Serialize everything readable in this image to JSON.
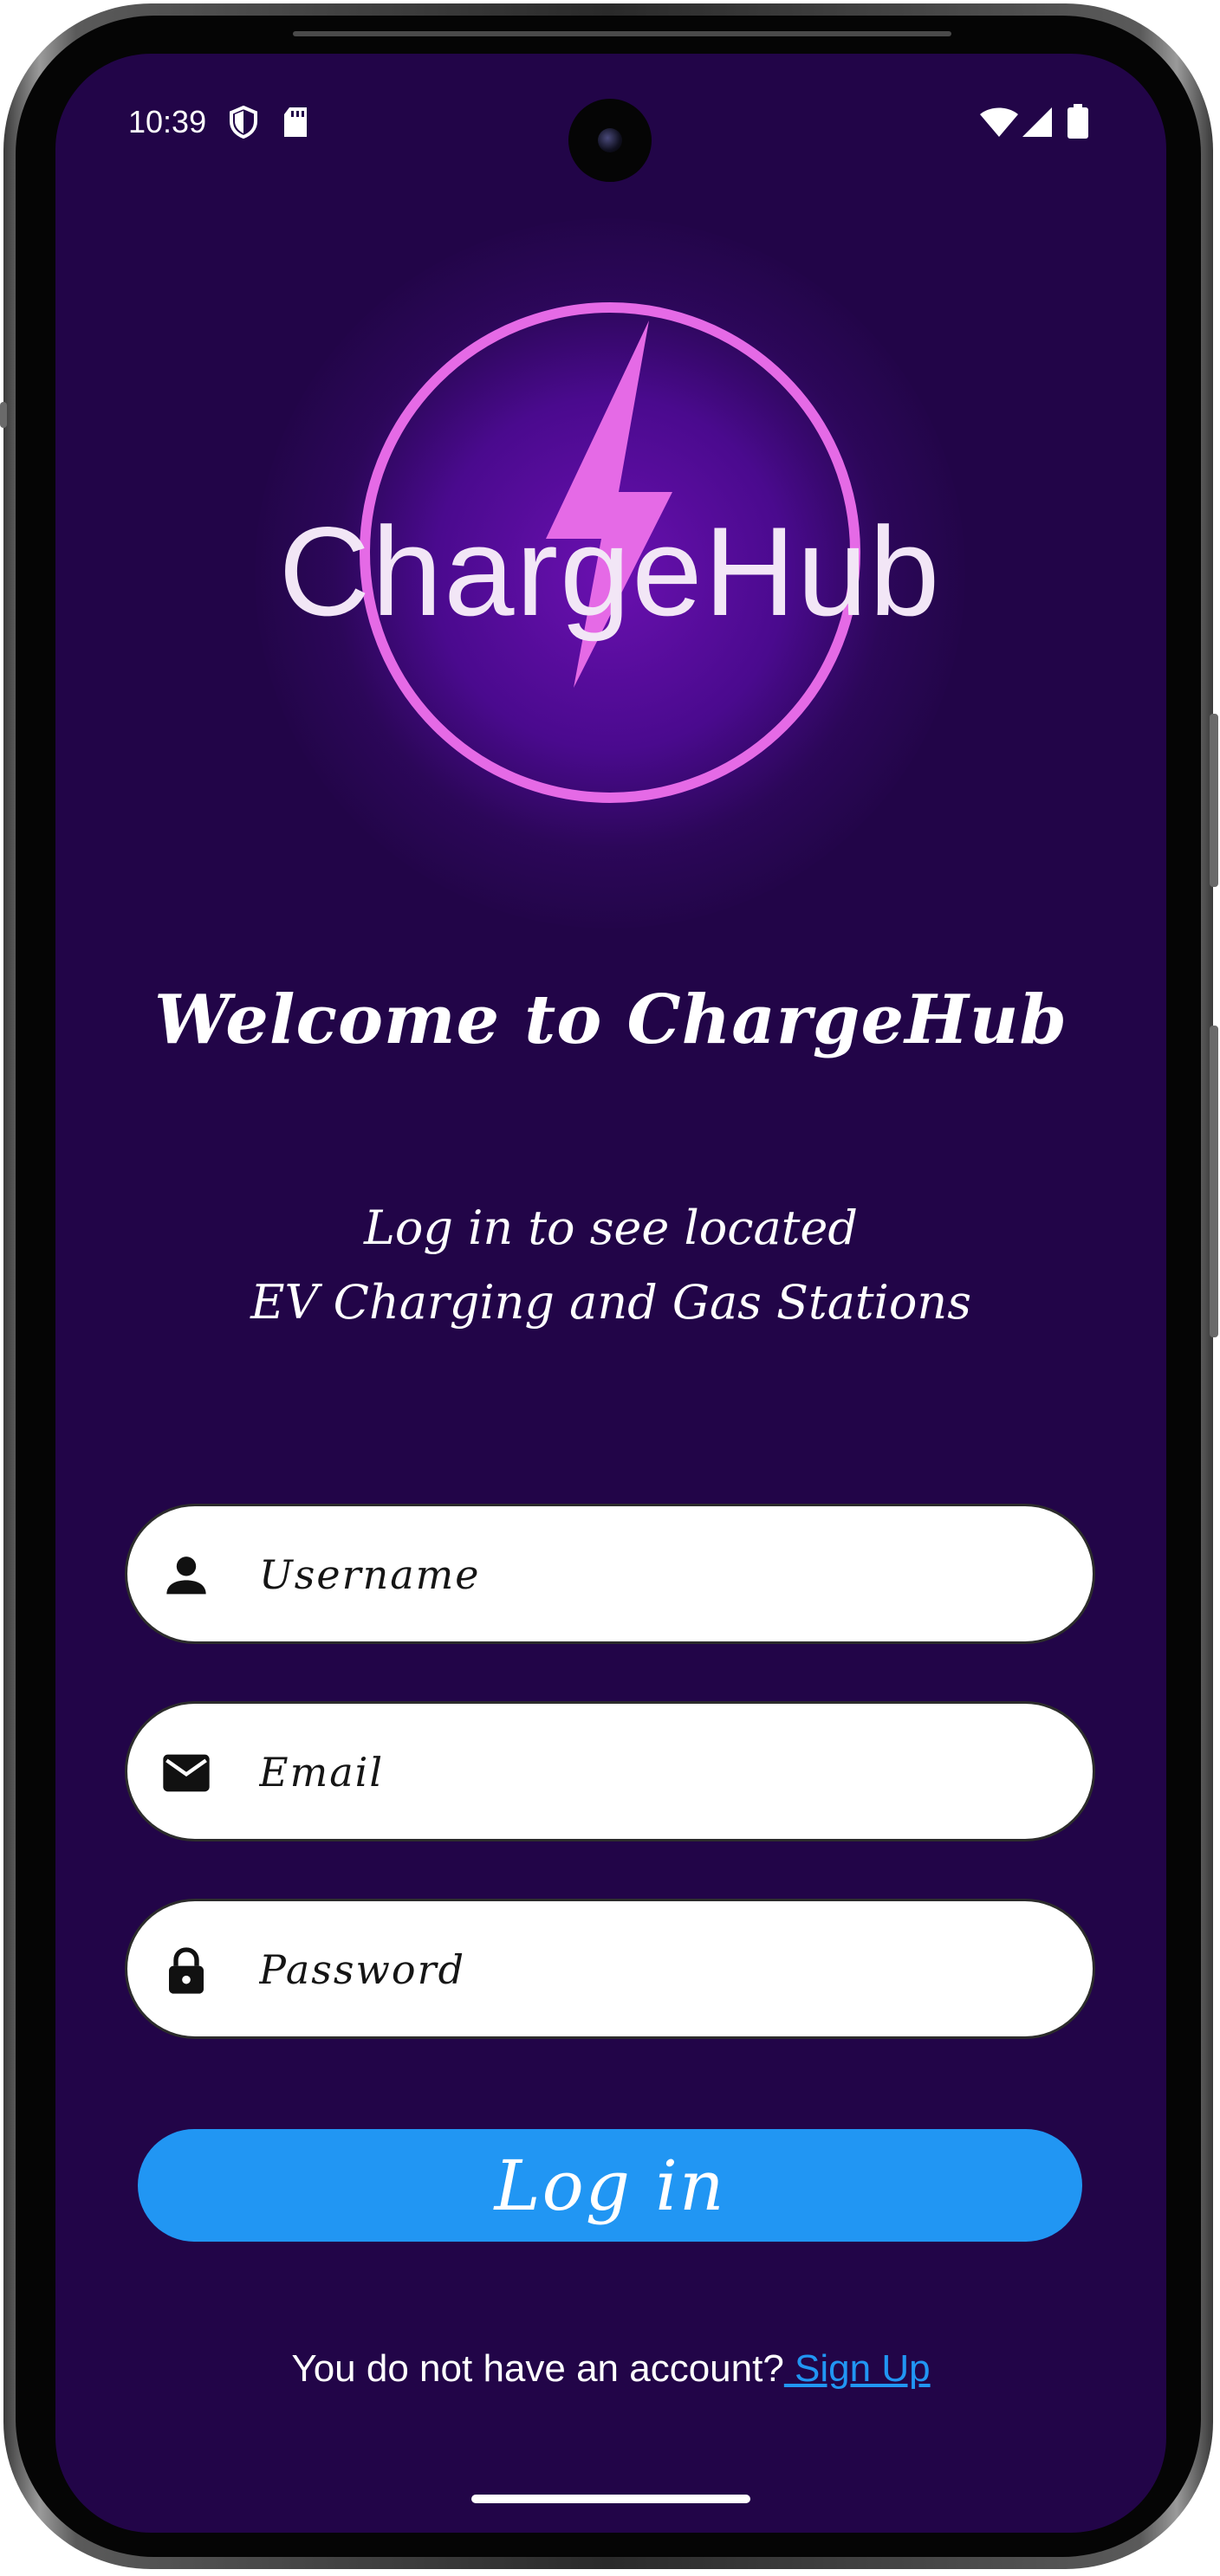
{
  "status_bar": {
    "time": "10:39",
    "icons": [
      "shield-icon",
      "sd-card-icon",
      "wifi-icon",
      "signal-icon",
      "battery-icon"
    ]
  },
  "logo": {
    "text": "ChargeHub",
    "accent_color": "#e56ae6",
    "icon": "lightning-bolt-icon"
  },
  "welcome": {
    "title": "Welcome to ChargeHub",
    "subtitle_line1": "Log in to see located",
    "subtitle_line2": "EV Charging and Gas Stations"
  },
  "form": {
    "username": {
      "placeholder": "Username",
      "value": "",
      "icon": "person-icon"
    },
    "email": {
      "placeholder": "Email",
      "value": "",
      "icon": "mail-icon"
    },
    "password": {
      "placeholder": "Password",
      "value": "",
      "icon": "lock-icon"
    },
    "login_label": "Log in"
  },
  "signup": {
    "prompt": "You do not have an account?",
    "link_label": " Sign Up"
  },
  "colors": {
    "background": "#220548",
    "button": "#2196f3",
    "link": "#2196f3"
  }
}
